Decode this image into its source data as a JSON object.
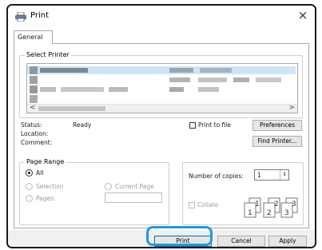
{
  "window": {
    "title": "Print",
    "close_glyph": "×"
  },
  "tabs": [
    {
      "label": "General"
    }
  ],
  "select_printer": {
    "legend": "Select Printer",
    "scroll_left": "<",
    "scroll_right": ">"
  },
  "status": {
    "status_label": "Status:",
    "status_value": "Ready",
    "location_label": "Location:",
    "comment_label": "Comment:",
    "print_to_file_label": "Print to file",
    "preferences_label": "Preferences",
    "find_printer_label": "Find Printer..."
  },
  "page_range": {
    "legend": "Page Range",
    "all_label": "All",
    "selection_label": "Selection",
    "current_page_label": "Current Page",
    "pages_label": "Pages:"
  },
  "copies": {
    "label": "Number of copies:",
    "value": "1",
    "collate_label": "Collate",
    "pages": [
      "1",
      "1",
      "2",
      "2",
      "3",
      "3"
    ]
  },
  "footer": {
    "print_label": "Print",
    "cancel_label": "Cancel",
    "apply_label": "Apply"
  },
  "colors": {
    "highlight": "#1d9be0",
    "footer": "#f0f0f0"
  }
}
